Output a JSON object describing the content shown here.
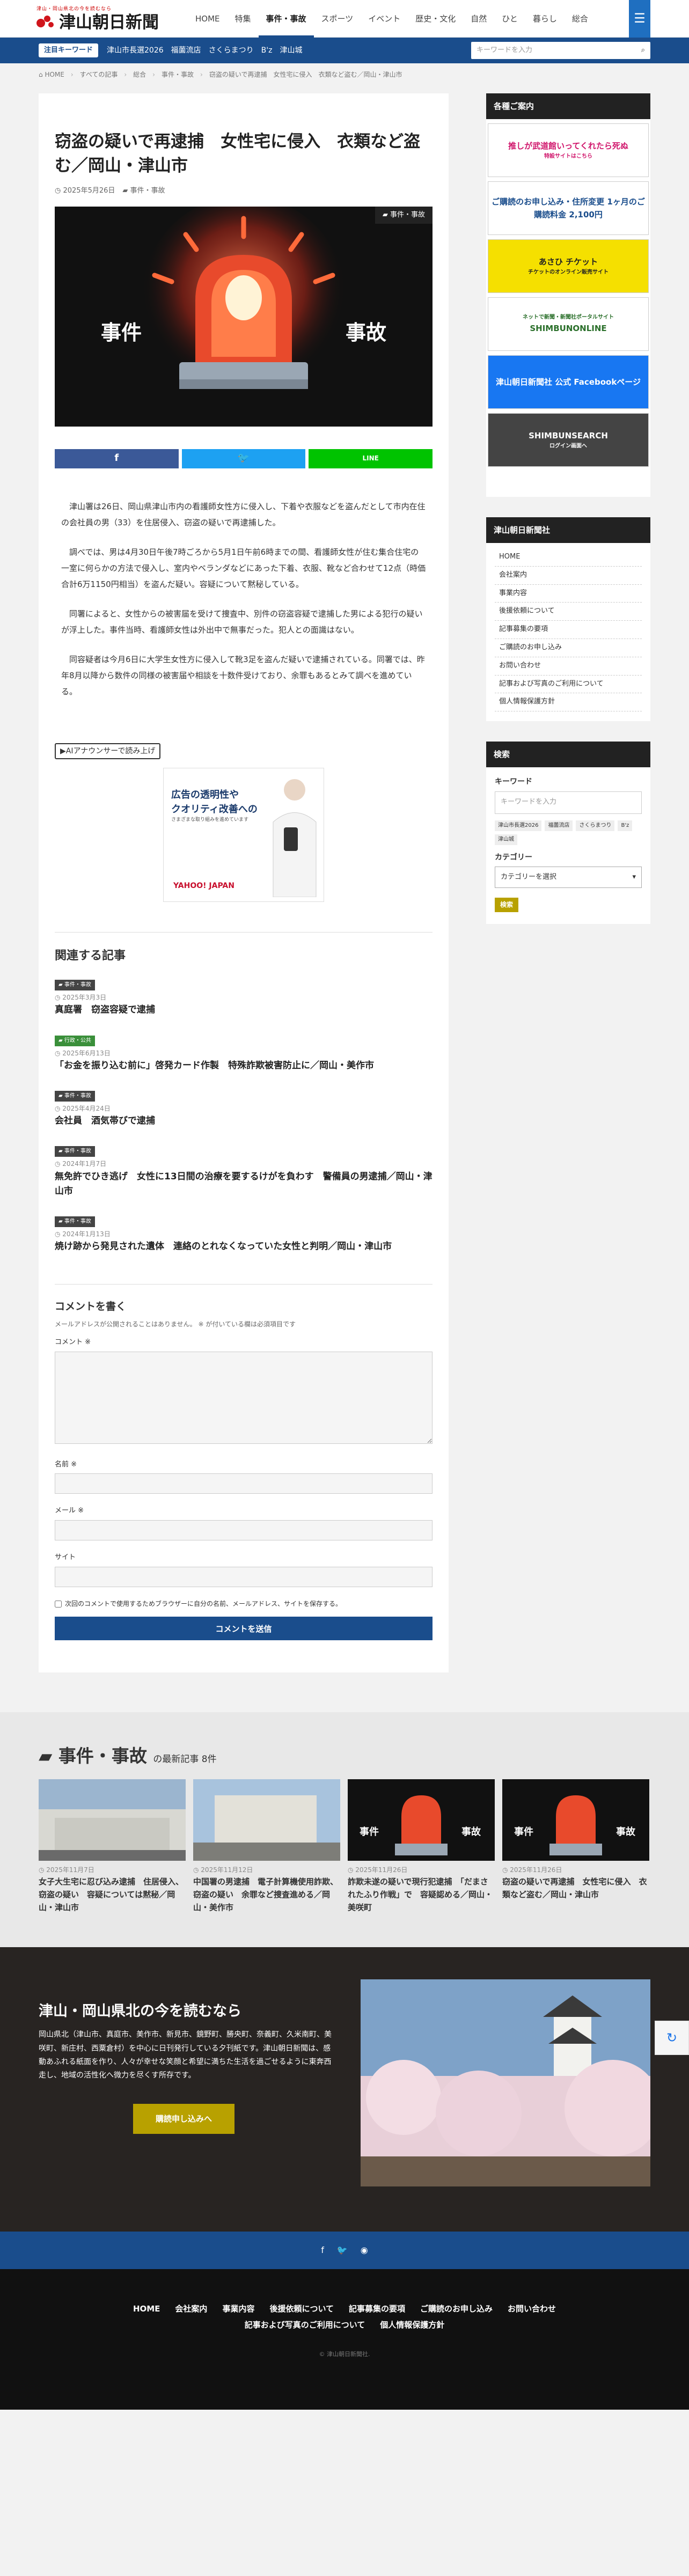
{
  "header": {
    "tagline": "津山・岡山県北の今を読むなら",
    "site_name": "津山朝日新聞",
    "nav": [
      "HOME",
      "特集",
      "事件・事故",
      "スポーツ",
      "イベント",
      "歴史・文化",
      "自然",
      "ひと",
      "暮らし",
      "総合"
    ],
    "active_nav": "事件・事故"
  },
  "keywords": {
    "label": "注目キーワード",
    "items": [
      "津山市長選2026",
      "福薗流店",
      "さくらまつり",
      "B'z",
      "津山城"
    ],
    "search_placeholder": "キーワードを入力"
  },
  "breadcrumb": [
    "HOME",
    "すべての記事",
    "総合",
    "事件・事故",
    "窃盗の疑いで再逮捕　女性宅に侵入　衣類など盗む／岡山・津山市"
  ],
  "article": {
    "title": "窃盗の疑いで再逮捕　女性宅に侵入　衣類など盗む／岡山・津山市",
    "date": "2025年5月26日",
    "category": "事件・事故",
    "hero_left": "事件",
    "hero_right": "事故",
    "paragraphs": [
      "津山署は26日、岡山県津山市内の看護師女性方に侵入し、下着や衣服などを盗んだとして市内在住の会社員の男（33）を住居侵入、窃盗の疑いで再逮捕した。",
      "調べでは、男は4月30日午後7時ごろから5月1日午前6時までの間、看護師女性が住む集合住宅の一室に何らかの方法で侵入し、室内やベランダなどにあった下着、衣服、靴など合わせて12点（時価合計6万1150円相当）を盗んだ疑い。容疑について黙秘している。",
      "同署によると、女性からの被害届を受けて捜査中、別件の窃盗容疑で逮捕した男による犯行の疑いが浮上した。事件当時、看護師女性は外出中で無事だった。犯人との面識はない。",
      "同容疑者は今月6日に大学生女性方に侵入して靴3足を盗んだ疑いで逮捕されている。同署では、昨年8月以降から数件の同様の被害届や相談を十数件受けており、余罪もあるとみて調べを進めている。"
    ],
    "tts_label": "▶AIアナウンサーで読み上げ",
    "ad_text1": "広告の透明性や",
    "ad_text2": "クオリティ改善への",
    "ad_text3": "さまざまな取り組みを進めています",
    "ad_brand": "YAHOO! JAPAN"
  },
  "related": {
    "title": "関連する記事",
    "items": [
      {
        "badge": "事件・事故",
        "date": "2025年3月3日",
        "title": "真庭署　窃盗容疑で逮捕",
        "green": false
      },
      {
        "badge": "行政・公共",
        "date": "2025年6月13日",
        "title": "「お金を振り込む前に」啓発カード作製　特殊詐欺被害防止に／岡山・美作市",
        "green": true
      },
      {
        "badge": "事件・事故",
        "date": "2025年4月24日",
        "title": "会社員　酒気帯びで逮捕",
        "green": false
      },
      {
        "badge": "事件・事故",
        "date": "2024年1月7日",
        "title": "無免許でひき逃げ　女性に13日間の治療を要するけがを負わす　警備員の男逮捕／岡山・津山市",
        "green": false
      },
      {
        "badge": "事件・事故",
        "date": "2024年1月13日",
        "title": "焼け跡から発見された遺体　連絡のとれなくなっていた女性と判明／岡山・津山市",
        "green": false
      }
    ]
  },
  "comment": {
    "title": "コメントを書く",
    "note": "メールアドレスが公開されることはありません。 ※ が付いている欄は必須項目です",
    "label_comment": "コメント ※",
    "label_name": "名前 ※",
    "label_email": "メール ※",
    "label_site": "サイト",
    "save_text": "次回のコメントで使用するためブラウザーに自分の名前、メールアドレス、サイトを保存する。",
    "submit": "コメントを送信"
  },
  "sidebar": {
    "guide_title": "各種ご案内",
    "banners": [
      {
        "text": "推しが武道館いってくれたら死ぬ",
        "sub": "特設サイトはこちら",
        "bg": "#ffffff",
        "fg": "#d0156b"
      },
      {
        "text": "ご購読のお申し込み・住所変更 1ヶ月のご購読料金 2,100円",
        "sub": "",
        "bg": "#ffffff",
        "fg": "#1a4d8c"
      },
      {
        "text": "あさひ チケット",
        "sub": "チケットのオンライン販売サイト",
        "bg": "#f5e000",
        "fg": "#222222"
      },
      {
        "text": "SHIMBUNONLINE",
        "sub": "ネットで新聞・新聞社ポータルサイト",
        "bg": "#ffffff",
        "fg": "#2a6f2a"
      },
      {
        "text": "津山朝日新聞社 公式 Facebookページ",
        "sub": "",
        "bg": "#1877f2",
        "fg": "#ffffff"
      },
      {
        "text": "SHIMBUNSEARCH",
        "sub": "ログイン画面へ",
        "bg": "#444444",
        "fg": "#ffffff"
      }
    ],
    "company_title": "津山朝日新聞社",
    "company_links": [
      "HOME",
      "会社案内",
      "事業内容",
      "後援依頼について",
      "記事募集の要項",
      "ご購読のお申し込み",
      "お問い合わせ",
      "記事および写真のご利用について",
      "個人情報保護方針"
    ],
    "search_title": "検索",
    "keyword_label": "キーワード",
    "keyword_placeholder": "キーワードを入力",
    "tags": [
      "津山市長選2026",
      "福薗流店",
      "さくらまつり",
      "B'z",
      "津山城"
    ],
    "category_label": "カテゴリー",
    "category_select": "カテゴリーを選択",
    "search_button": "検索"
  },
  "latest": {
    "title": "事件・事故",
    "subtitle": "の最新記事",
    "count": "8件",
    "cards": [
      {
        "date": "2025年11月7日",
        "title": "女子大生宅に忍び込み逮捕　住居侵入、窃盗の疑い　容疑については黙秘／岡山・津山市"
      },
      {
        "date": "2025年11月12日",
        "title": "中国署の男逮捕　電子計算機使用詐欺、窃盗の疑い　余罪など捜査進める／岡山・美作市"
      },
      {
        "date": "2025年11月26日",
        "title": "詐欺未遂の疑いで現行犯逮捕　「だまされたふり作戦」で　容疑認める／岡山・美咲町"
      },
      {
        "date": "2025年11月26日",
        "title": "窃盗の疑いで再逮捕　女性宅に侵入　衣類など盗む／岡山・津山市"
      }
    ]
  },
  "promo": {
    "title": "津山・岡山県北の今を読むなら",
    "text": "岡山県北（津山市、真庭市、美作市、新見市、鏡野町、勝央町、奈義町、久米南町、美咲町、新庄村、西粟倉村）を中心に日刊発行している夕刊紙です。津山朝日新聞は、感動あふれる紙面を作り、人々が幸せな笑顔と希望に満ちた生活を過ごせるように東奔西走し、地域の活性化へ微力を尽くす所存です。",
    "button": "購読申し込みへ"
  },
  "footer": {
    "links": [
      "HOME",
      "会社案内",
      "事業内容",
      "後援依頼について",
      "記事募集の要項",
      "ご購読のお申し込み",
      "お問い合わせ",
      "記事および写真のご利用について",
      "個人情報保護方針"
    ],
    "copyright": "© 津山朝日新聞社."
  }
}
